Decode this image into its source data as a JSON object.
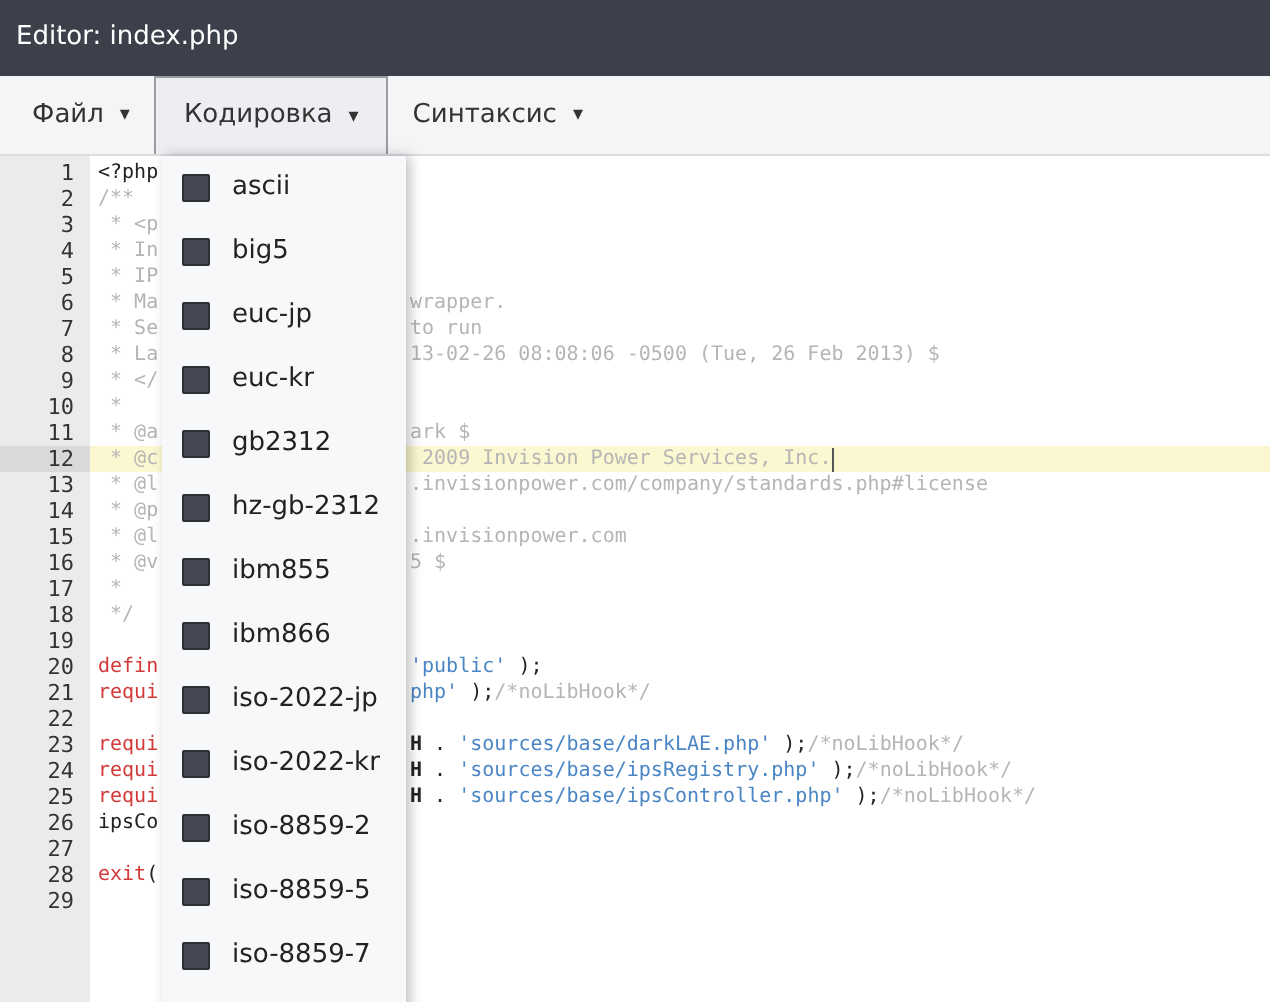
{
  "window": {
    "title": "Editor: index.php"
  },
  "menu": [
    {
      "label": "Файл",
      "caret": "▾",
      "selected": false
    },
    {
      "label": "Кодировка",
      "caret": "▾",
      "selected": true
    },
    {
      "label": "Синтаксис",
      "caret": "▾",
      "selected": false
    }
  ],
  "encoding_menu": [
    {
      "label": "ascii",
      "checked": false
    },
    {
      "label": "big5",
      "checked": false
    },
    {
      "label": "euc-jp",
      "checked": false
    },
    {
      "label": "euc-kr",
      "checked": false
    },
    {
      "label": "gb2312",
      "checked": false
    },
    {
      "label": "hz-gb-2312",
      "checked": false
    },
    {
      "label": "ibm855",
      "checked": false
    },
    {
      "label": "ibm866",
      "checked": false
    },
    {
      "label": "iso-2022-jp",
      "checked": false
    },
    {
      "label": "iso-2022-kr",
      "checked": false
    },
    {
      "label": "iso-8859-2",
      "checked": false
    },
    {
      "label": "iso-8859-5",
      "checked": false
    },
    {
      "label": "iso-8859-7",
      "checked": false
    }
  ],
  "code_lines": [
    {
      "number": "1",
      "current": false,
      "left": [
        {
          "kind": "plain",
          "text": "<?php"
        }
      ]
    },
    {
      "number": "2",
      "current": false,
      "left": [
        {
          "kind": "comment",
          "text": "/**"
        }
      ]
    },
    {
      "number": "3",
      "current": false,
      "left": [
        {
          "kind": "comment",
          "text": " * <p"
        }
      ]
    },
    {
      "number": "4",
      "current": false,
      "left": [
        {
          "kind": "comment",
          "text": " * In"
        }
      ]
    },
    {
      "number": "5",
      "current": false,
      "left": [
        {
          "kind": "comment",
          "text": " * IP"
        }
      ]
    },
    {
      "number": "6",
      "current": false,
      "left": [
        {
          "kind": "comment",
          "text": " * Ma"
        }
      ],
      "right": [
        {
          "kind": "comment",
          "text": "wrapper."
        }
      ]
    },
    {
      "number": "7",
      "current": false,
      "left": [
        {
          "kind": "comment",
          "text": " * Se"
        }
      ],
      "right": [
        {
          "kind": "comment",
          "text": "to run"
        }
      ]
    },
    {
      "number": "8",
      "current": false,
      "left": [
        {
          "kind": "comment",
          "text": " * La"
        }
      ],
      "right": [
        {
          "kind": "comment",
          "text": "13-02-26 08:08:06 -0500 (Tue, 26 Feb 2013) $"
        }
      ]
    },
    {
      "number": "9",
      "current": false,
      "left": [
        {
          "kind": "comment",
          "text": " * </"
        }
      ]
    },
    {
      "number": "10",
      "current": false,
      "left": [
        {
          "kind": "comment",
          "text": " *"
        }
      ]
    },
    {
      "number": "11",
      "current": false,
      "left": [
        {
          "kind": "comment",
          "text": " * @a"
        }
      ],
      "right": [
        {
          "kind": "comment",
          "text": "ark $"
        }
      ]
    },
    {
      "number": "12",
      "current": true,
      "left": [
        {
          "kind": "comment",
          "text": " * @c"
        }
      ],
      "right": [
        {
          "kind": "comment",
          "text": " 2009 Invision Power Services, Inc."
        }
      ]
    },
    {
      "number": "13",
      "current": false,
      "left": [
        {
          "kind": "comment",
          "text": " * @l"
        }
      ],
      "right": [
        {
          "kind": "comment",
          "text": ".invisionpower.com/company/standards.php#license"
        }
      ]
    },
    {
      "number": "14",
      "current": false,
      "left": [
        {
          "kind": "comment",
          "text": " * @p"
        }
      ]
    },
    {
      "number": "15",
      "current": false,
      "left": [
        {
          "kind": "comment",
          "text": " * @l"
        }
      ],
      "right": [
        {
          "kind": "comment",
          "text": ".invisionpower.com"
        }
      ]
    },
    {
      "number": "16",
      "current": false,
      "left": [
        {
          "kind": "comment",
          "text": " * @v"
        }
      ],
      "right": [
        {
          "kind": "comment",
          "text": "5 $"
        }
      ]
    },
    {
      "number": "17",
      "current": false,
      "left": [
        {
          "kind": "comment",
          "text": " *"
        }
      ]
    },
    {
      "number": "18",
      "current": false,
      "left": [
        {
          "kind": "comment",
          "text": " */"
        }
      ]
    },
    {
      "number": "19",
      "current": false
    },
    {
      "number": "20",
      "current": false,
      "left": [
        {
          "kind": "keyword",
          "text": "defin"
        }
      ],
      "right": [
        {
          "kind": "string",
          "text": "'public'"
        },
        {
          "kind": "plain",
          "text": " );"
        }
      ]
    },
    {
      "number": "21",
      "current": false,
      "left": [
        {
          "kind": "keyword",
          "text": "requi"
        }
      ],
      "right": [
        {
          "kind": "string",
          "text": "php'"
        },
        {
          "kind": "plain",
          "text": " );"
        },
        {
          "kind": "comment",
          "text": "/*noLibHook*/"
        }
      ]
    },
    {
      "number": "22",
      "current": false
    },
    {
      "number": "23",
      "current": false,
      "left": [
        {
          "kind": "keyword",
          "text": "requi"
        }
      ],
      "right": [
        {
          "kind": "constant",
          "text": "H"
        },
        {
          "kind": "plain",
          "text": " . "
        },
        {
          "kind": "string",
          "text": "'sources/base/darkLAE.php'"
        },
        {
          "kind": "plain",
          "text": " );"
        },
        {
          "kind": "comment",
          "text": "/*noLibHook*/"
        }
      ]
    },
    {
      "number": "24",
      "current": false,
      "left": [
        {
          "kind": "keyword",
          "text": "requi"
        }
      ],
      "right": [
        {
          "kind": "constant",
          "text": "H"
        },
        {
          "kind": "plain",
          "text": " . "
        },
        {
          "kind": "string",
          "text": "'sources/base/ipsRegistry.php'"
        },
        {
          "kind": "plain",
          "text": " );"
        },
        {
          "kind": "comment",
          "text": "/*noLibHook*/"
        }
      ]
    },
    {
      "number": "25",
      "current": false,
      "left": [
        {
          "kind": "keyword",
          "text": "requi"
        }
      ],
      "right": [
        {
          "kind": "constant",
          "text": "H"
        },
        {
          "kind": "plain",
          "text": " . "
        },
        {
          "kind": "string",
          "text": "'sources/base/ipsController.php'"
        },
        {
          "kind": "plain",
          "text": " );"
        },
        {
          "kind": "comment",
          "text": "/*noLibHook*/"
        }
      ]
    },
    {
      "number": "26",
      "current": false,
      "left": [
        {
          "kind": "plain",
          "text": "ipsCo"
        }
      ]
    },
    {
      "number": "27",
      "current": false
    },
    {
      "number": "28",
      "current": false,
      "left": [
        {
          "kind": "keyword",
          "text": "exit"
        },
        {
          "kind": "plain",
          "text": "("
        }
      ]
    },
    {
      "number": "29",
      "current": false
    }
  ]
}
